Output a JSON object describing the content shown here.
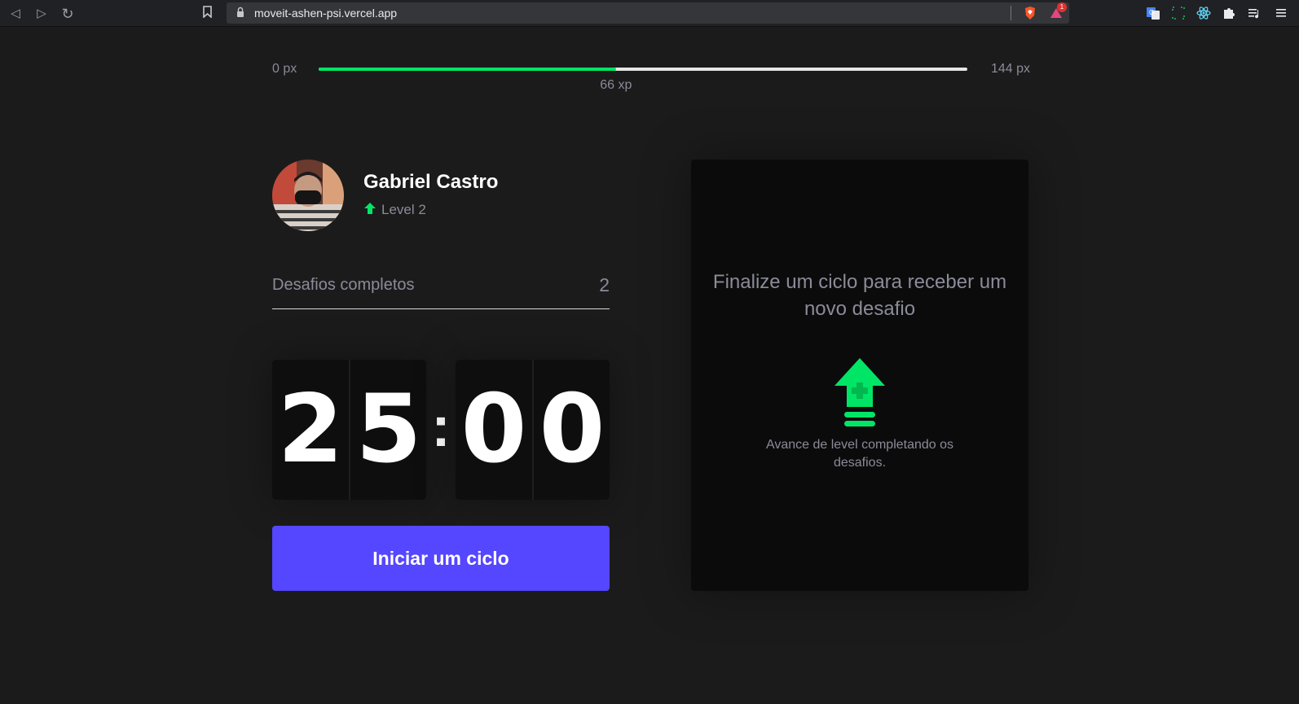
{
  "browser": {
    "url": "moveit-ashen-psi.vercel.app",
    "notification_count": "1"
  },
  "experience": {
    "min_label": "0 px",
    "max_label": "144 px",
    "current_label": "66 xp",
    "current": 66,
    "max": 144,
    "fill_color": "#00e566"
  },
  "profile": {
    "name": "Gabriel Castro",
    "level_label": "Level 2"
  },
  "challenges": {
    "label": "Desafios completos",
    "count": "2"
  },
  "countdown": {
    "minute_left": "2",
    "minute_right": "5",
    "separator": ":",
    "second_left": "0",
    "second_right": "0"
  },
  "actions": {
    "start_label": "Iniciar um ciclo",
    "accent_color": "#5546ff"
  },
  "challenge_box": {
    "title": "Finalize um ciclo para receber um novo desafio",
    "description": "Avance de level completando os desafios.",
    "icon": "level-up-icon"
  }
}
